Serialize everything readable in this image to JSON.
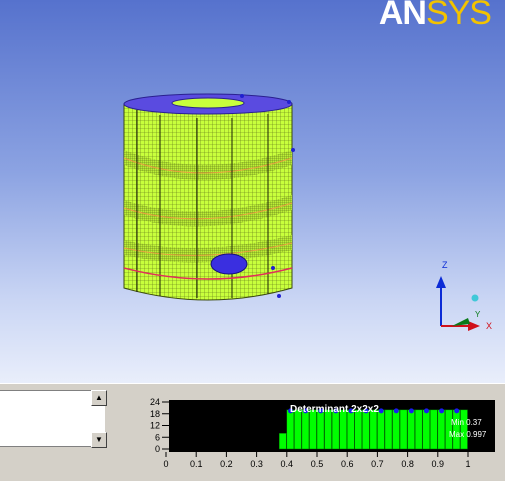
{
  "logo": {
    "part1": "AN",
    "part2": "SYS"
  },
  "triad": {
    "z": "Z",
    "y": "Y",
    "x": "X"
  },
  "histogram": {
    "title": "Determinant 2x2x2",
    "min": "Min 0.37",
    "max": "Max 0.997",
    "y_ticks": [
      "24",
      "18",
      "12",
      "6",
      "0"
    ],
    "x_ticks": [
      "0",
      "0.1",
      "0.2",
      "0.3",
      "0.4",
      "0.5",
      "0.6",
      "0.7",
      "0.8",
      "0.9",
      "1"
    ]
  },
  "chart_data": {
    "type": "bar",
    "title": "Determinant 2x2x2",
    "xlim": [
      0,
      1
    ],
    "ylim": [
      0,
      24
    ],
    "bin_width": 0.025,
    "bins_x": [
      0.35,
      0.375,
      0.4,
      0.425,
      0.45,
      0.475,
      0.5,
      0.525,
      0.55,
      0.575,
      0.6,
      0.625,
      0.65,
      0.675,
      0.7,
      0.725,
      0.75,
      0.775,
      0.8,
      0.825,
      0.85,
      0.875,
      0.9,
      0.925,
      0.95,
      0.975
    ],
    "values": [
      0,
      8,
      20,
      20,
      20,
      20,
      20,
      20,
      20,
      20,
      20,
      20,
      20,
      20,
      20,
      20,
      20,
      20,
      20,
      20,
      20,
      20,
      20,
      20,
      20,
      20
    ],
    "colors": {
      "bar": "#00ff00",
      "background": "#000000",
      "marker": "#1c1cf0"
    }
  },
  "colors": {
    "mesh": "#c8ff3c",
    "cap": "#5a4be0",
    "accent_line": "#e0305a"
  }
}
